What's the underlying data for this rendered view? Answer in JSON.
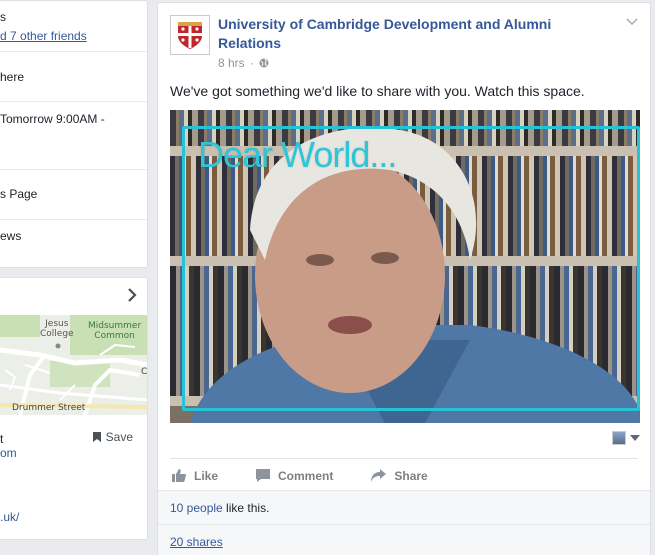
{
  "left_card": {
    "friends_line_1": "s",
    "friends_line_2": "d 7 other friends",
    "here": "here",
    "event_line": "Tomorrow 9:00AM -",
    "page_line": "s Page",
    "news_line": "ews"
  },
  "map_card": {
    "labels": {
      "jesus_college": "Jesus\nCollege",
      "midsummer_common": "Midsummer\nCommon",
      "drummer_street": "Drummer Street",
      "edge_letter": "C"
    },
    "save_label": "Save",
    "line_om": "om",
    "line_uk": ".uk/",
    "line_t": "t"
  },
  "post": {
    "page_name": "University of Cambridge Development and Alumni Relations",
    "time": "8 hrs",
    "message": "We've got something we'd like to share with you. Watch this space.",
    "media_title": "Dear World...",
    "actions": {
      "like": "Like",
      "comment": "Comment",
      "share": "Share"
    },
    "likes_link": "10 people",
    "likes_suffix": " like this.",
    "shares_link": "20 shares"
  },
  "colors": {
    "link": "#365899",
    "accent_cyan": "#27c2d6",
    "background": "#e9ebee"
  }
}
